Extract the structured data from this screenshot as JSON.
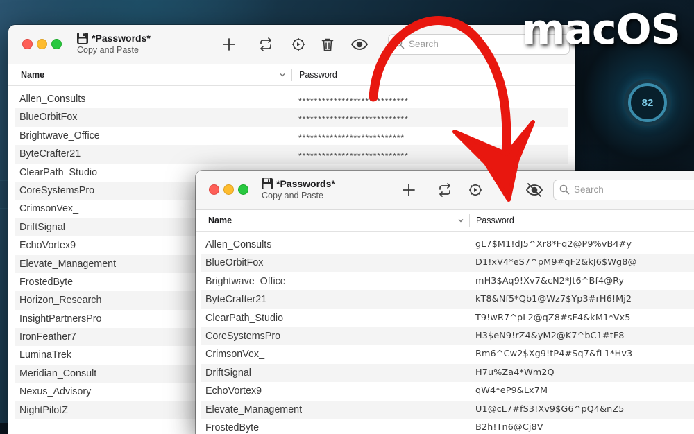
{
  "overlay_label": "macOS",
  "desktop": {
    "gauge_text": "82"
  },
  "accent": {
    "arrow_color": "#e8170f",
    "close": "#fe5f57",
    "minimize": "#febc2e",
    "zoom": "#28c840"
  },
  "back_window": {
    "title": "*Passwords*",
    "subtitle": "Copy and Paste",
    "toolbar": {
      "add_icon": "plus-icon",
      "sync_icon": "sync-icon",
      "settings_icon": "gear-icon",
      "delete_icon": "trash-icon",
      "reveal_icon": "eye-icon"
    },
    "search_placeholder": "Search",
    "columns": {
      "name": "Name",
      "password": "Password"
    },
    "rows": [
      {
        "name": "Allen_Consults",
        "password": "****************************"
      },
      {
        "name": "BlueOrbitFox",
        "password": "****************************"
      },
      {
        "name": "Brightwave_Office",
        "password": "***************************"
      },
      {
        "name": "ByteCrafter21",
        "password": "****************************"
      },
      {
        "name": "ClearPath_Studio",
        "password": ""
      },
      {
        "name": "CoreSystemsPro",
        "password": ""
      },
      {
        "name": "CrimsonVex_",
        "password": ""
      },
      {
        "name": "DriftSignal",
        "password": ""
      },
      {
        "name": "EchoVortex9",
        "password": ""
      },
      {
        "name": "Elevate_Management",
        "password": ""
      },
      {
        "name": "FrostedByte",
        "password": ""
      },
      {
        "name": "Horizon_Research",
        "password": ""
      },
      {
        "name": "InsightPartnersPro",
        "password": ""
      },
      {
        "name": "IronFeather7",
        "password": ""
      },
      {
        "name": "LuminaTrek",
        "password": ""
      },
      {
        "name": "Meridian_Consult",
        "password": ""
      },
      {
        "name": "Nexus_Advisory",
        "password": ""
      },
      {
        "name": "NightPilotZ",
        "password": ""
      }
    ]
  },
  "front_window": {
    "title": "*Passwords*",
    "subtitle": "Copy and Paste",
    "toolbar": {
      "add_icon": "plus-icon",
      "sync_icon": "sync-icon",
      "settings_icon": "gear-icon",
      "reveal_icon": "eye-slash-icon"
    },
    "search_placeholder": "Search",
    "columns": {
      "name": "Name",
      "password": "Password"
    },
    "rows": [
      {
        "name": "Allen_Consults",
        "password": "gL7$M1!dJ5^Xr8*Fq2@P9%vB4#y"
      },
      {
        "name": "BlueOrbitFox",
        "password": "D1!xV4*eS7^pM9#qF2&kJ6$Wg8@"
      },
      {
        "name": "Brightwave_Office",
        "password": "mH3$Aq9!Xv7&cN2*Jt6^Bf4@Ry"
      },
      {
        "name": "ByteCrafter21",
        "password": "kT8&Nf5*Qb1@Wz7$Yp3#rH6!Mj2"
      },
      {
        "name": "ClearPath_Studio",
        "password": "T9!wR7^pL2@qZ8#sF4&kM1*Vx5"
      },
      {
        "name": "CoreSystemsPro",
        "password": "H3$eN9!rZ4&yM2@K7^bC1#tF8"
      },
      {
        "name": "CrimsonVex_",
        "password": "Rm6^Cw2$Xg9!tP4#Sq7&fL1*Hv3"
      },
      {
        "name": "DriftSignal",
        "password": "H7u%Za4*Wm2Q"
      },
      {
        "name": "EchoVortex9",
        "password": "qW4*eP9&Lx7M"
      },
      {
        "name": "Elevate_Management",
        "password": "U1@cL7#fS3!Xv9$G6^pQ4&nZ5"
      },
      {
        "name": "FrostedByte",
        "password": "B2h!Tn6@Cj8V"
      }
    ]
  }
}
